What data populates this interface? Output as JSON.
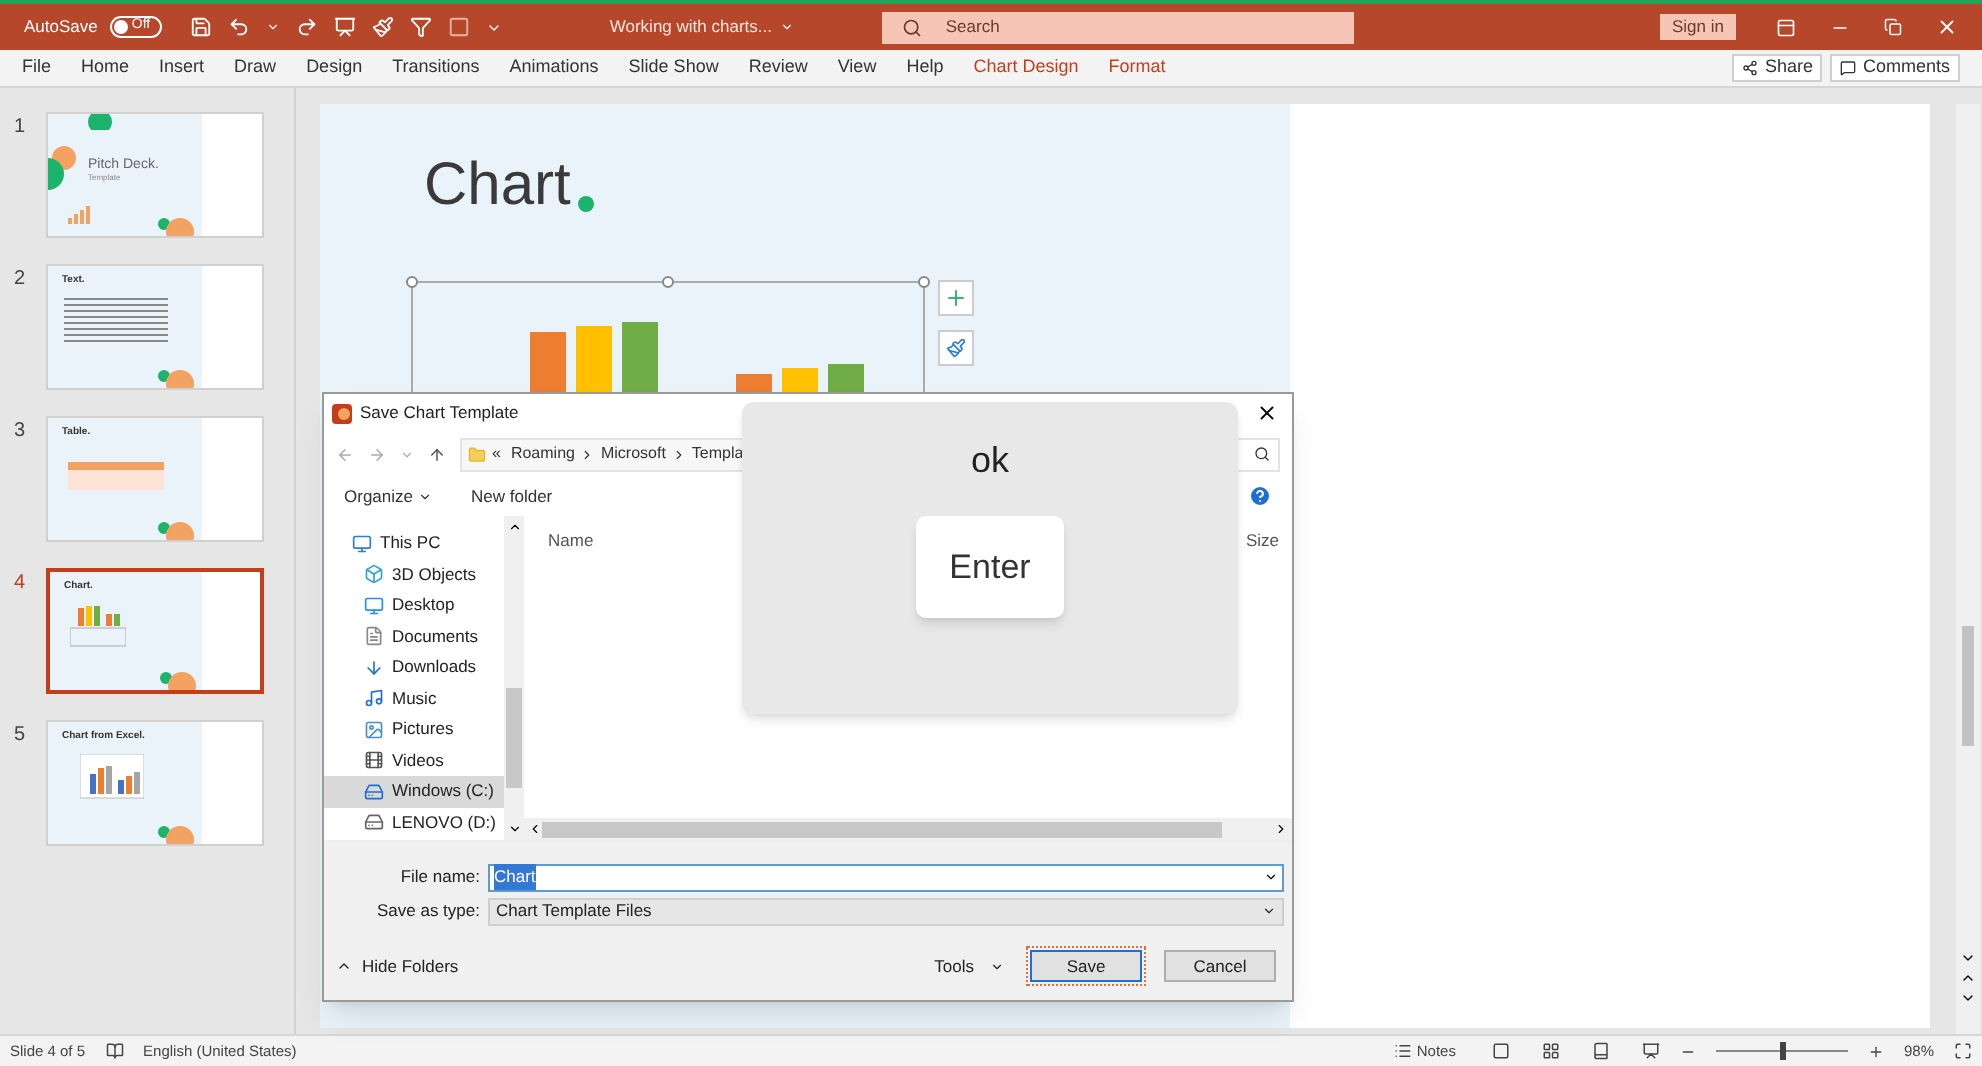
{
  "title_bar": {
    "autosave_label": "AutoSave",
    "autosave_state": "Off",
    "autosave_on": false,
    "doc_title": "Working with charts...",
    "search_placeholder": "Search",
    "sign_in": "Sign in"
  },
  "ribbon_tabs": [
    {
      "label": "File",
      "kind": "normal"
    },
    {
      "label": "Home",
      "kind": "normal"
    },
    {
      "label": "Insert",
      "kind": "normal"
    },
    {
      "label": "Draw",
      "kind": "normal"
    },
    {
      "label": "Design",
      "kind": "normal"
    },
    {
      "label": "Transitions",
      "kind": "normal"
    },
    {
      "label": "Animations",
      "kind": "normal"
    },
    {
      "label": "Slide Show",
      "kind": "normal"
    },
    {
      "label": "Review",
      "kind": "normal"
    },
    {
      "label": "View",
      "kind": "normal"
    },
    {
      "label": "Help",
      "kind": "normal"
    },
    {
      "label": "Chart Design",
      "kind": "contextual"
    },
    {
      "label": "Format",
      "kind": "contextual"
    }
  ],
  "share": "Share",
  "comments": "Comments",
  "slides": [
    {
      "number": "1",
      "title": "Pitch Deck.",
      "subtitle": "Template",
      "kind": "title",
      "selected": false
    },
    {
      "number": "2",
      "title": "Text.",
      "kind": "text",
      "selected": false
    },
    {
      "number": "3",
      "title": "Table.",
      "kind": "table",
      "selected": false
    },
    {
      "number": "4",
      "title": "Chart.",
      "kind": "chart",
      "selected": true
    },
    {
      "number": "5",
      "title": "Chart from Excel.",
      "kind": "excel",
      "selected": false
    }
  ],
  "slide": {
    "title": "Chart"
  },
  "dialog": {
    "title": "Save Chart Template",
    "overflow": "«",
    "breadcrumb": [
      "Roaming",
      "Microsoft",
      "Templa"
    ],
    "organize": "Organize",
    "new_folder": "New folder",
    "folders": [
      {
        "label": "This PC",
        "kind": "pc",
        "selected": false,
        "children": [
          {
            "label": "3D Objects",
            "kind": "objects",
            "selected": false
          },
          {
            "label": "Desktop",
            "kind": "desktop",
            "selected": false
          },
          {
            "label": "Documents",
            "kind": "documents",
            "selected": false
          },
          {
            "label": "Downloads",
            "kind": "downloads",
            "selected": false
          },
          {
            "label": "Music",
            "kind": "music",
            "selected": false
          },
          {
            "label": "Pictures",
            "kind": "pictures",
            "selected": false
          },
          {
            "label": "Videos",
            "kind": "videos",
            "selected": false
          },
          {
            "label": "Windows (C:)",
            "kind": "drive",
            "selected": true
          },
          {
            "label": "LENOVO (D:)",
            "kind": "drive2",
            "selected": false
          }
        ]
      }
    ],
    "columns": [
      "Name",
      "Size"
    ],
    "file_name_label": "File name:",
    "file_name": "Chart",
    "file_name_selected": true,
    "save_type_label": "Save as type:",
    "save_type": "Chart Template Files",
    "hide_folders": "Hide Folders",
    "tools": "Tools",
    "save": "Save",
    "cancel": "Cancel"
  },
  "key_overlay": {
    "caption": "ok",
    "key": "Enter"
  },
  "status_bar": {
    "slide": "Slide 4 of 5",
    "language": "English (United States)",
    "notes": "Notes",
    "zoom": "98%",
    "level": 0.5
  }
}
